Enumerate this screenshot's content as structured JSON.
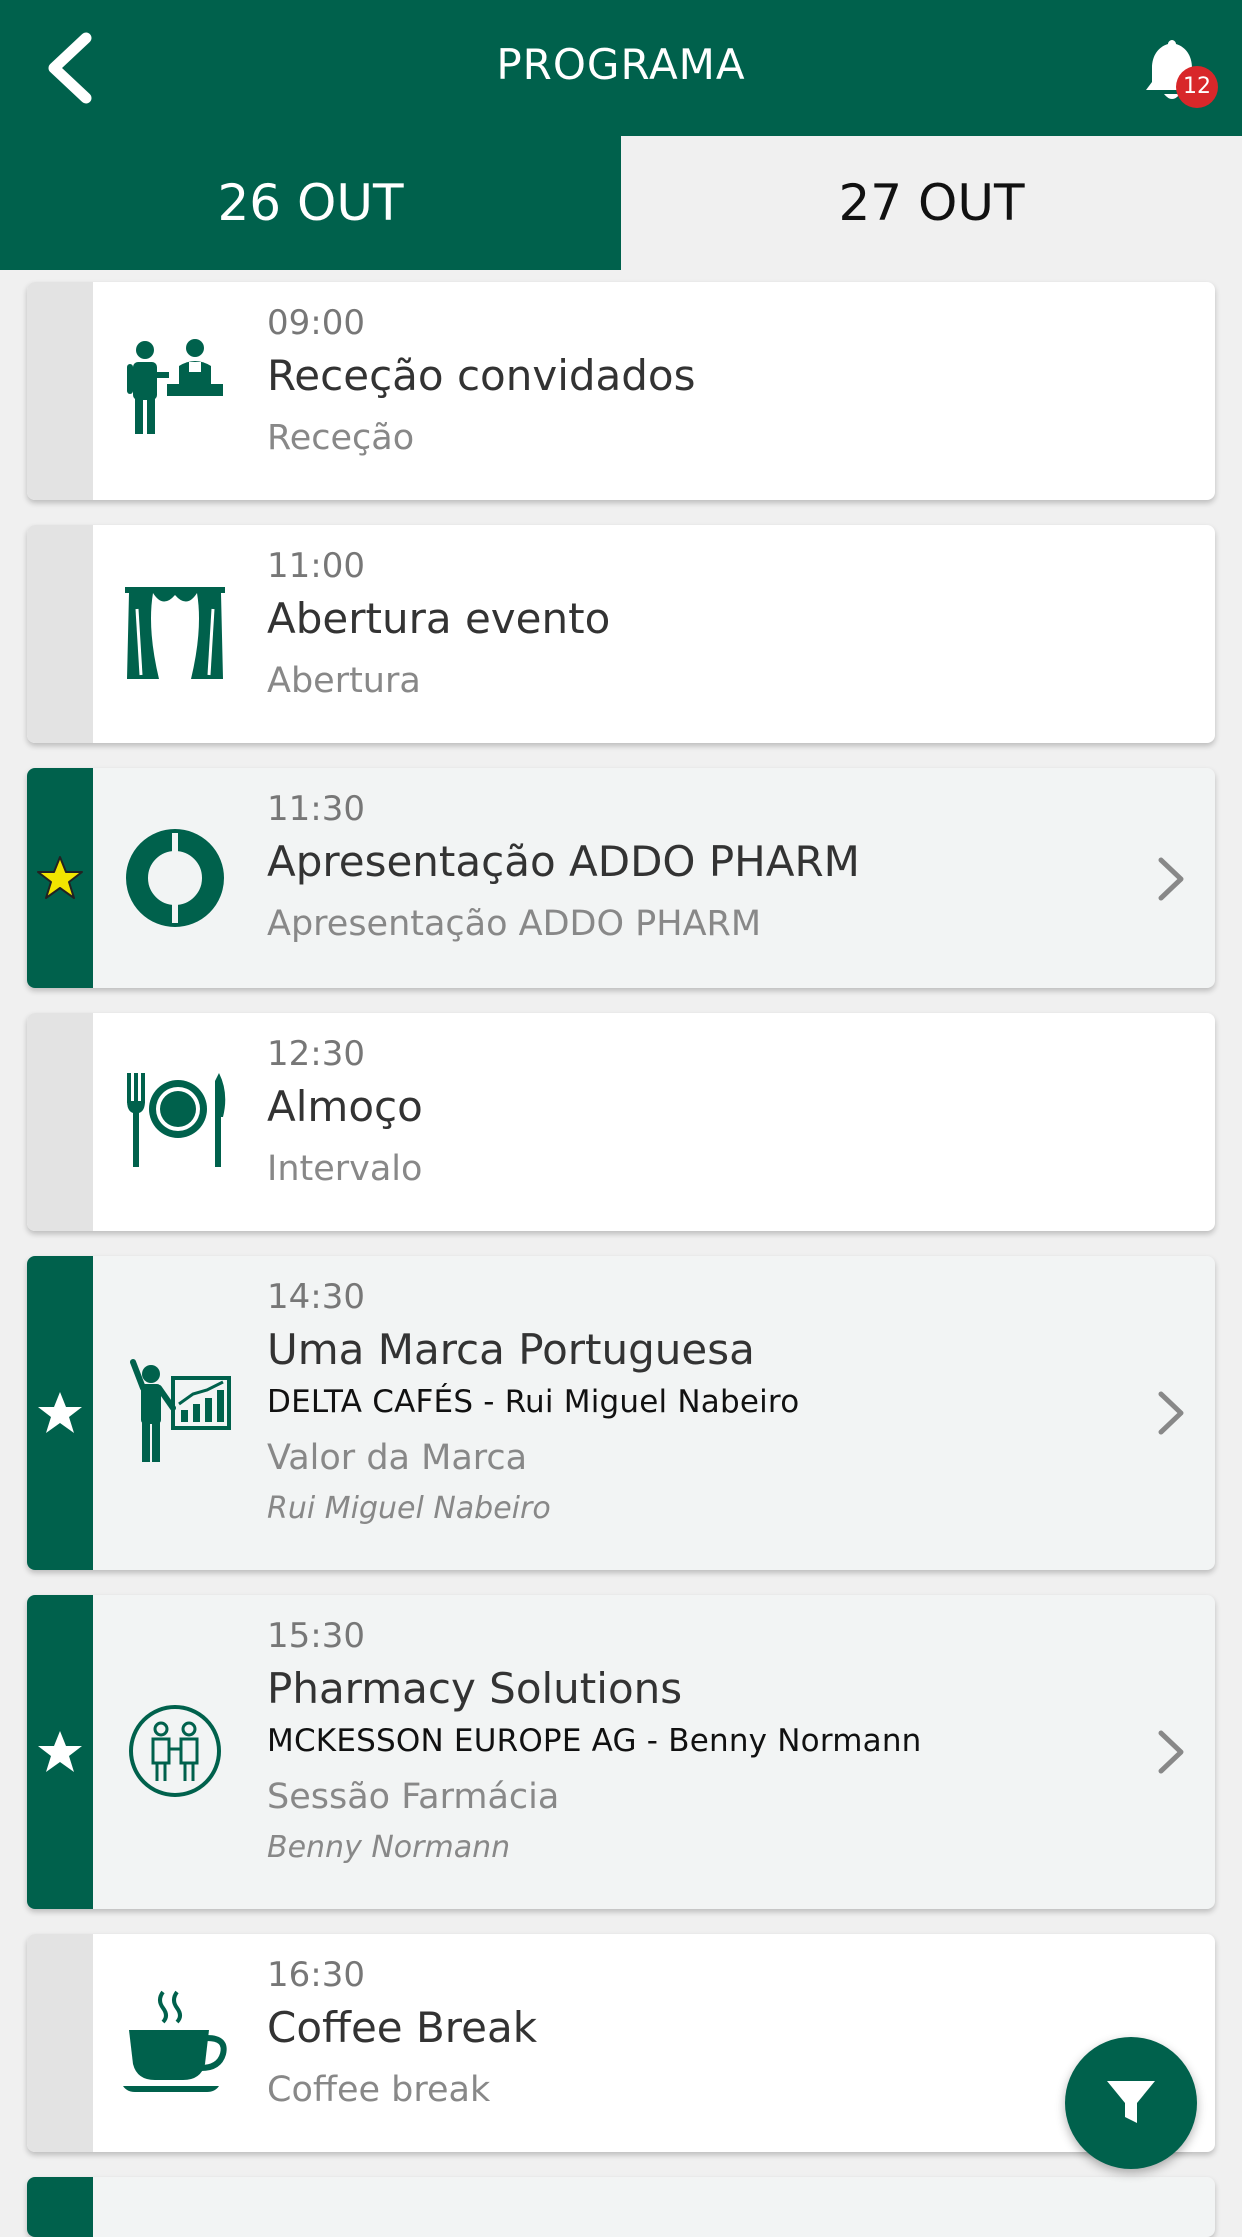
{
  "header": {
    "title": "PROGRAMA",
    "notifications_count": "12",
    "icons": {
      "back": "back-chevron-icon",
      "bell": "bell-icon"
    }
  },
  "tabs": [
    {
      "label": "26 OUT",
      "active": true
    },
    {
      "label": "27 OUT",
      "active": false
    }
  ],
  "colors": {
    "brand": "#00614c",
    "badge": "#d8272a",
    "star_selected": "#f2e600"
  },
  "sessions": [
    {
      "time": "09:00",
      "title": "Receção convidados",
      "category": "Receção",
      "icon": "reception-desk-icon",
      "favorite": false
    },
    {
      "time": "11:00",
      "title": "Abertura evento",
      "category": "Abertura",
      "icon": "theater-curtain-icon",
      "favorite": false
    },
    {
      "time": "11:30",
      "title": "Apresentação ADDO PHARM",
      "category": "Apresentação ADDO PHARM",
      "icon": "addo-pharm-logo-icon",
      "favorite": true,
      "star": "yellow"
    },
    {
      "time": "12:30",
      "title": "Almoço",
      "category": "Intervalo",
      "icon": "fork-plate-knife-icon",
      "favorite": false
    },
    {
      "time": "14:30",
      "title": "Uma Marca Portuguesa",
      "subtitle": "DELTA CAFÉS - Rui Miguel Nabeiro",
      "category": "Valor da Marca",
      "speaker": "Rui Miguel Nabeiro",
      "icon": "presenter-chart-icon",
      "favorite": true,
      "star": "white"
    },
    {
      "time": "15:30",
      "title": "Pharmacy Solutions",
      "subtitle": "MCKESSON EUROPE AG - Benny Normann",
      "category": "Sessão Farmácia",
      "speaker": "Benny Normann",
      "icon": "handshake-people-icon",
      "favorite": true,
      "star": "white"
    },
    {
      "time": "16:30",
      "title": "Coffee Break",
      "category": "Coffee break",
      "icon": "coffee-cup-icon",
      "favorite": false
    }
  ],
  "fab": {
    "icon": "filter-icon"
  }
}
